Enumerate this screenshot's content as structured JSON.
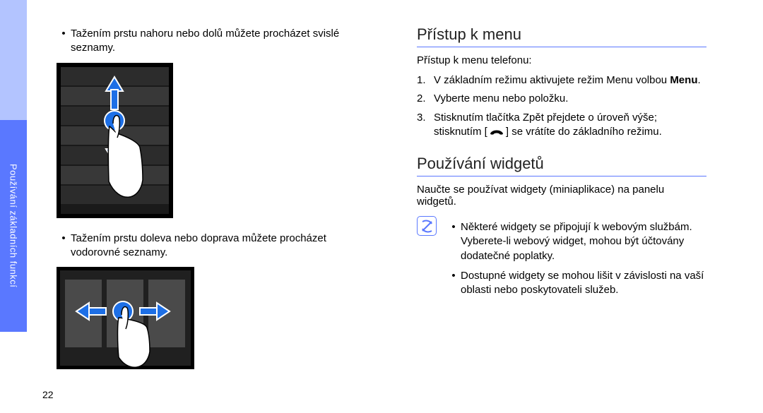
{
  "sidebar": {
    "label": "Používání základních funkcí"
  },
  "left": {
    "bullet1": "Tažením prstu nahoru nebo dolů můžete procházet svislé seznamy.",
    "bullet2": "Tažením prstu doleva nebo doprava můžete procházet vodorovné seznamy."
  },
  "right": {
    "h1": "Přístup k menu",
    "intro": "Přístup k menu telefonu:",
    "steps": {
      "n1": "1.",
      "s1a": "V základním režimu aktivujete režim Menu volbou ",
      "s1b": "Menu",
      "s1c": ".",
      "n2": "2.",
      "s2": "Vyberte menu nebo položku.",
      "n3": "3.",
      "s3a": "Stisknutím tlačítka Zpět přejdete o úroveň výše; stisknutím [",
      "s3b": "] se vrátíte do základního režimu."
    },
    "h2": "Používání widgetů",
    "p2": "Naučte se používat widgety (miniaplikace) na panelu widgetů.",
    "note1": "Některé widgety se připojují k webovým službám. Vyberete-li webový widget, mohou být účtovány dodatečné poplatky.",
    "note2": "Dostupné widgety se mohou lišit v závislosti na vaší oblasti nebo poskytovateli služeb."
  },
  "pageNumber": "22"
}
